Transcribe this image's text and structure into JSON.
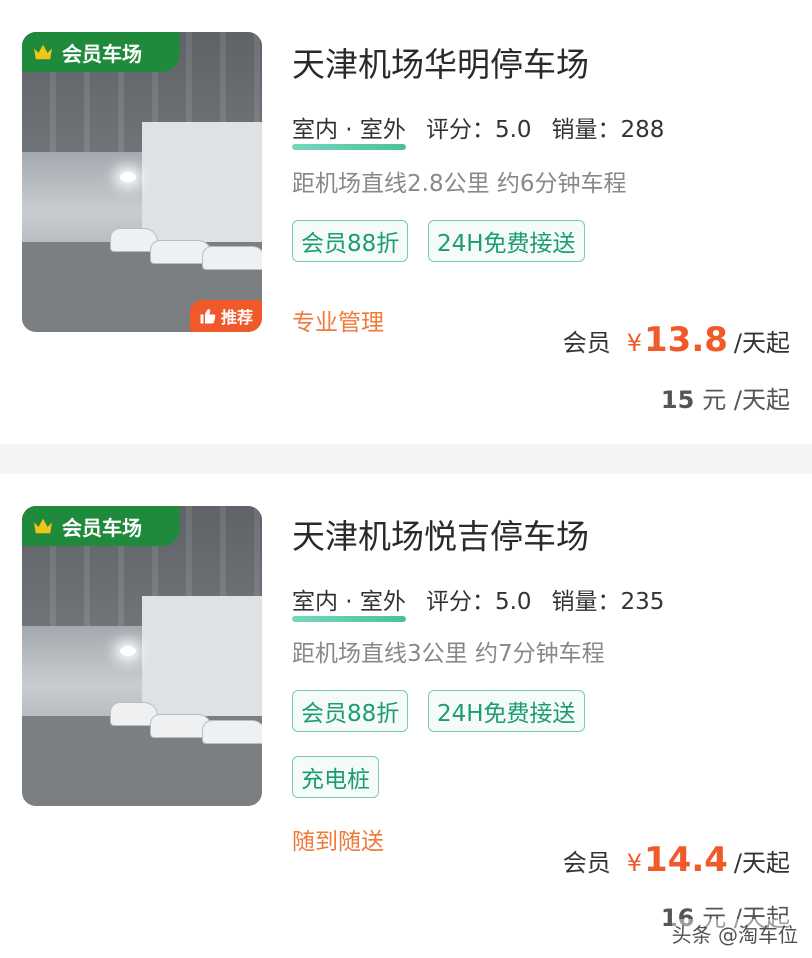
{
  "listings": [
    {
      "member_badge": "会员车场",
      "recommend_badge": "推荐",
      "title": "天津机场华明停车场",
      "indoor": "室内 · 室外",
      "rating": "评分：5.0",
      "sales": "销量：288",
      "distance": "距机场直线2.8公里 约6分钟车程",
      "tags": [
        "会员88折",
        "24H免费接送"
      ],
      "feature": "专业管理",
      "member_label": "会员",
      "currency": "¥",
      "member_price": "13.8",
      "per_day": "/天起",
      "orig_price": "15",
      "orig_unit": "元 /天起"
    },
    {
      "member_badge": "会员车场",
      "title": "天津机场悦吉停车场",
      "indoor": "室内 · 室外",
      "rating": "评分：5.0",
      "sales": "销量：235",
      "distance": "距机场直线3公里 约7分钟车程",
      "tags": [
        "会员88折",
        "24H免费接送",
        "充电桩"
      ],
      "feature": "随到随送",
      "member_label": "会员",
      "currency": "¥",
      "member_price": "14.4",
      "per_day": "/天起",
      "orig_price": "16",
      "orig_unit": "元 /天起"
    }
  ],
  "watermark": "头条 @淘车位",
  "colors": {
    "member_green": "#1f8a3c",
    "tag_green": "#1d9b72",
    "price_orange": "#f05a2a",
    "feature_orange": "#f07a3a"
  }
}
